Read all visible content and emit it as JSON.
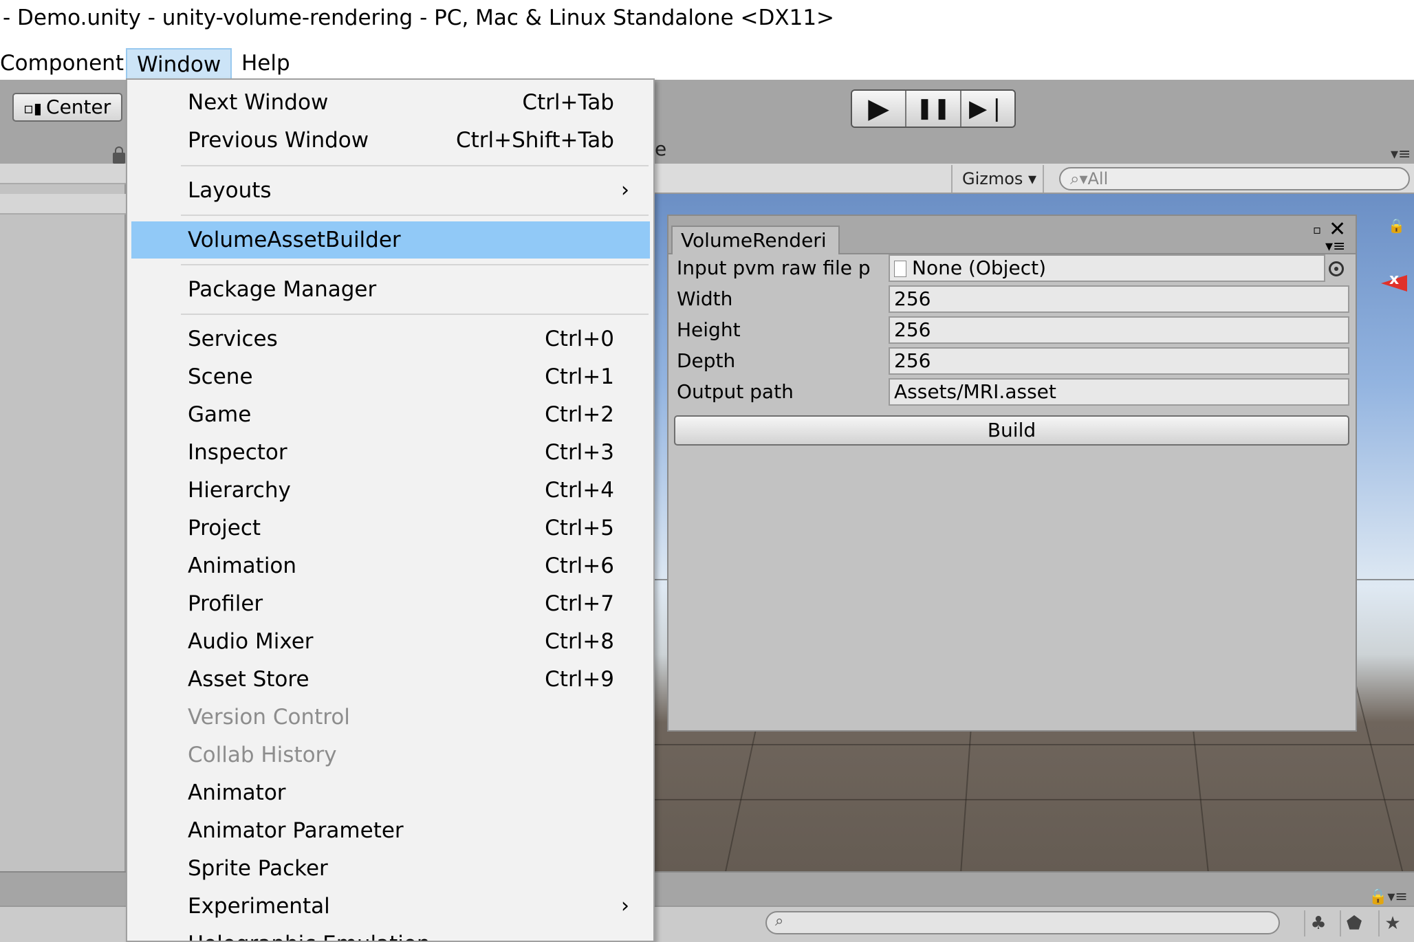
{
  "window_title": "- Demo.unity - unity-volume-rendering - PC, Mac & Linux Standalone <DX11>",
  "menubar": {
    "items": [
      "Component",
      "Window",
      "Help"
    ],
    "active": "Window"
  },
  "toolbar": {
    "pivot_label": "Center",
    "play_icon": "▶",
    "pause_icon": "❚❚",
    "step_icon": "▶❘"
  },
  "scene": {
    "gizmos_label": "Gizmos ▾",
    "search_placeholder": "All",
    "partial_tab_text": "e"
  },
  "window_menu": {
    "items": [
      {
        "label": "Next Window",
        "shortcut": "Ctrl+Tab"
      },
      {
        "label": "Previous Window",
        "shortcut": "Ctrl+Shift+Tab"
      },
      {
        "label": "Layouts",
        "shortcut": "",
        "submenu": true
      },
      {
        "label": "VolumeAssetBuilder",
        "shortcut": "",
        "highlighted": true
      },
      {
        "label": "Package Manager",
        "shortcut": ""
      },
      {
        "label": "Services",
        "shortcut": "Ctrl+0"
      },
      {
        "label": "Scene",
        "shortcut": "Ctrl+1"
      },
      {
        "label": "Game",
        "shortcut": "Ctrl+2"
      },
      {
        "label": "Inspector",
        "shortcut": "Ctrl+3"
      },
      {
        "label": "Hierarchy",
        "shortcut": "Ctrl+4"
      },
      {
        "label": "Project",
        "shortcut": "Ctrl+5"
      },
      {
        "label": "Animation",
        "shortcut": "Ctrl+6"
      },
      {
        "label": "Profiler",
        "shortcut": "Ctrl+7"
      },
      {
        "label": "Audio Mixer",
        "shortcut": "Ctrl+8"
      },
      {
        "label": "Asset Store",
        "shortcut": "Ctrl+9"
      },
      {
        "label": "Version Control",
        "shortcut": "",
        "disabled": true
      },
      {
        "label": "Collab History",
        "shortcut": "",
        "disabled": true
      },
      {
        "label": "Animator",
        "shortcut": ""
      },
      {
        "label": "Animator Parameter",
        "shortcut": ""
      },
      {
        "label": "Sprite Packer",
        "shortcut": ""
      },
      {
        "label": "Experimental",
        "shortcut": "",
        "submenu": true
      },
      {
        "label": "Holographic Emulation",
        "shortcut": ""
      }
    ],
    "submenu_arrow": "›"
  },
  "volume_window": {
    "tab_label": "VolumeRenderi",
    "close_glyph": "✕",
    "maximize_glyph": "▫",
    "menu_glyph": "▾≡",
    "fields": {
      "input_label": "Input pvm raw file p",
      "input_value": "None (Object)",
      "width_label": "Width",
      "width_value": "256",
      "height_label": "Height",
      "height_value": "256",
      "depth_label": "Depth",
      "depth_value": "256",
      "output_label": "Output path",
      "output_value": "Assets/MRI.asset"
    },
    "build_label": "Build"
  },
  "scene_gizmo_axis": "x",
  "colors": {
    "menu_highlight": "#91c9f7",
    "menubar_active": "#cce4f7",
    "editor_gray": "#c2c2c2",
    "gizmo_red": "#e0322a"
  }
}
